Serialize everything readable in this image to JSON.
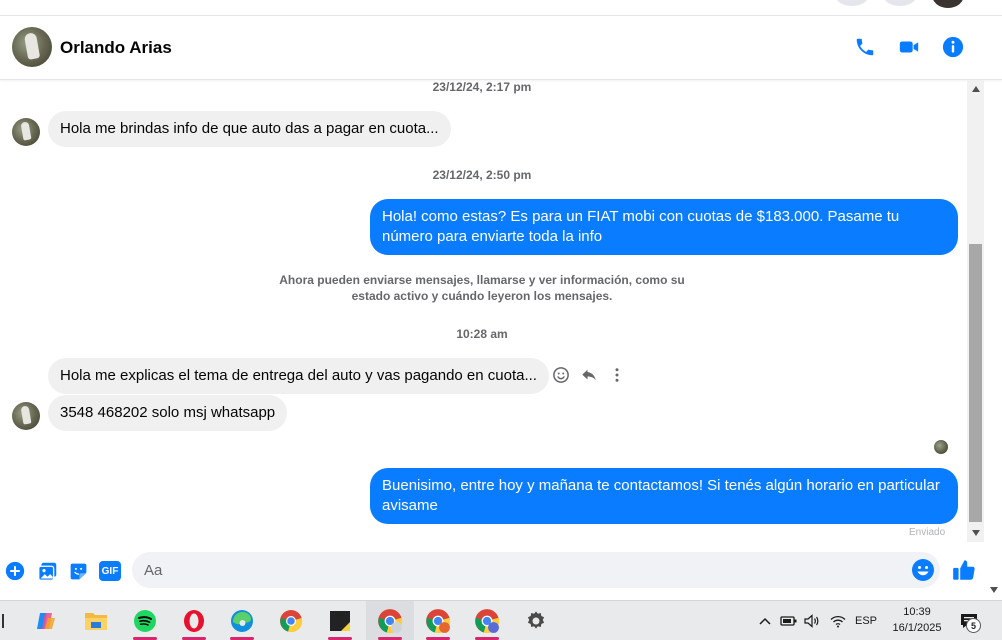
{
  "header": {
    "contact_name": "Orlando Arias"
  },
  "messages": {
    "ts1": "23/12/24, 2:17 pm",
    "in1": "Hola me brindas info de que auto das a pagar en cuota...",
    "ts2": "23/12/24, 2:50 pm",
    "out1": "Hola! como estas? Es para un FIAT mobi con cuotas de $183.000. Pasame tu número para enviarte toda la info",
    "notice": "Ahora pueden enviarse mensajes, llamarse y ver información, como su estado activo y cuándo leyeron los mensajes.",
    "ts3": "10:28 am",
    "in2": "Hola me explicas el tema de entrega del auto y vas pagando en cuota...",
    "in3": "3548 468202 solo msj whatsapp",
    "out2": "Buenisimo, entre hoy y mañana te contactamos! Si tenés algún horario en particular avisame",
    "status": "Enviado"
  },
  "composer": {
    "placeholder": "Aa",
    "gif_label": "GIF"
  },
  "taskbar": {
    "lang": "ESP",
    "time": "10:39",
    "date": "16/1/2025",
    "notif_count": "5"
  },
  "colors": {
    "accent": "#0a7cff",
    "incoming_bubble": "#f0f0f0",
    "taskbar_indicator": "#d7266d"
  }
}
